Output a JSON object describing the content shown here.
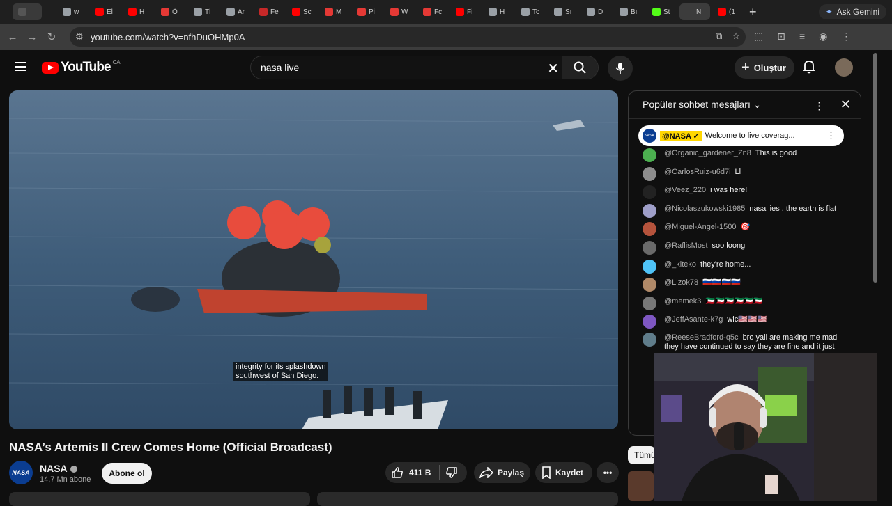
{
  "browser": {
    "tabs": [
      {
        "label": "",
        "color": "#555555"
      },
      {
        "label": "w",
        "color": "#9aa0a6"
      },
      {
        "label": "El",
        "color": "#ff0000"
      },
      {
        "label": "H",
        "color": "#ff0000"
      },
      {
        "label": "Ö",
        "color": "#e53935"
      },
      {
        "label": "Tl",
        "color": "#9aa0a6"
      },
      {
        "label": "Ar",
        "color": "#9aa0a6"
      },
      {
        "label": "Fe",
        "color": "#c62828"
      },
      {
        "label": "Sc",
        "color": "#ff0000"
      },
      {
        "label": "M",
        "color": "#e53935"
      },
      {
        "label": "Pi",
        "color": "#e53935"
      },
      {
        "label": "W",
        "color": "#e53935"
      },
      {
        "label": "Fc",
        "color": "#e53935"
      },
      {
        "label": "Fi",
        "color": "#ff0000"
      },
      {
        "label": "H",
        "color": "#9aa0a6"
      },
      {
        "label": "Tc",
        "color": "#9aa0a6"
      },
      {
        "label": "Sı",
        "color": "#9aa0a6"
      },
      {
        "label": "D",
        "color": "#9aa0a6"
      },
      {
        "label": "Bı",
        "color": "#9aa0a6"
      },
      {
        "label": "St",
        "color": "#53fc18"
      },
      {
        "label": "N",
        "color": "#3c3c3c"
      },
      {
        "label": "(1",
        "color": "#ff0000"
      }
    ],
    "new_tab": "+",
    "gemini_label": "Ask Gemini",
    "url": "youtube.com/watch?v=nfhDuOHMp0A"
  },
  "youtube": {
    "logo_text": "YouTube",
    "country": "CA",
    "search_value": "nasa live",
    "create_label": "Oluştur"
  },
  "video": {
    "caption": "integrity for its splashdown\nsouthwest of San Diego.",
    "title": "NASA’s Artemis II Crew Comes Home (Official Broadcast)",
    "channel": "NASA",
    "subscribers": "14,7 Mn abone",
    "subscribe_label": "Abone ol",
    "likes": "411 B",
    "share_label": "Paylaş",
    "save_label": "Kaydet"
  },
  "chat": {
    "header": "Popüler sohbet mesajları",
    "pinned": {
      "author": "@NASA ✓",
      "text": "Welcome to live coverag..."
    },
    "messages": [
      {
        "author": "@Organic_gardener_Zn8",
        "text": "This is good",
        "color": "#4caf50"
      },
      {
        "author": "@CarlosRuiz-u6d7i",
        "text": "Ll",
        "color": "#8d8d8d"
      },
      {
        "author": "@Veez_220",
        "text": "i was here!",
        "color": "#222222"
      },
      {
        "author": "@Nicolaszukowski1985",
        "text": "nasa lies . the earth is flat",
        "color": "#9e9ec8"
      },
      {
        "author": "@Miguel-Angel-1500",
        "text": "🎯",
        "color": "#b5533c"
      },
      {
        "author": "@RaflisMost",
        "text": "soo loong",
        "color": "#6a6a6a"
      },
      {
        "author": "@_kiteko",
        "text": "they're home...",
        "color": "#4fc3f7"
      },
      {
        "author": "@Lizok78",
        "text": "🇷🇺🇷🇺🇷🇺🇷🇺",
        "color": "#b08968"
      },
      {
        "author": "@memek3",
        "text": "🇰🇼🇰🇼🇰🇼🇰🇼🇰🇼🇰🇼",
        "color": "#777777"
      },
      {
        "author": "@JeffAsante-k7g",
        "text": "wlc🇺🇸🇺🇸🇺🇸",
        "color": "#7e57c2"
      },
      {
        "author": "@ReeseBradford-q5c",
        "text": "bro yall are making me mad they have continued to say they are fine and it just",
        "color": "#607d8b"
      }
    ]
  },
  "sidebar": {
    "filter_label": "Tümü"
  }
}
